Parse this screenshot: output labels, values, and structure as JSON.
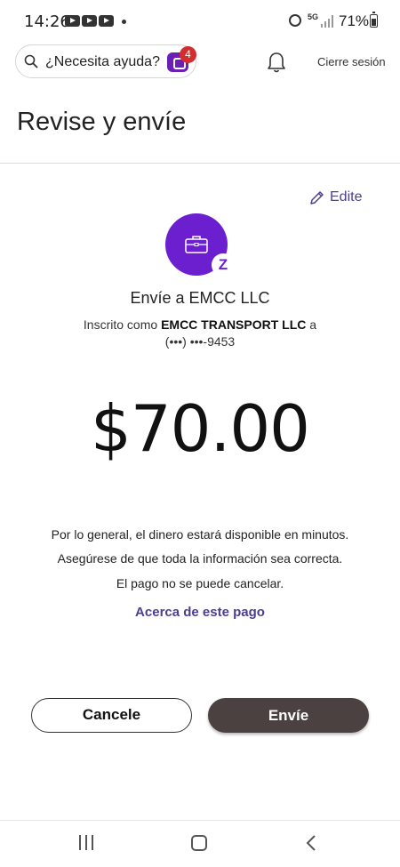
{
  "status_bar": {
    "time": "14:26",
    "battery": "71%",
    "network": "5G"
  },
  "top_nav": {
    "search_placeholder": "¿Necesita ayuda?",
    "chat_badge_count": "4",
    "logout_label": "Cierre sesión"
  },
  "page": {
    "title": "Revise y envíe",
    "edit_label": "Edite"
  },
  "recipient": {
    "send_to": "Envíe a EMCC LLC",
    "enrolled_prefix": "Inscrito como ",
    "enrolled_name": "EMCC TRANSPORT LLC",
    "enrolled_suffix": " a",
    "phone_masked": "(•••) •••-9453"
  },
  "payment": {
    "amount": "$70.00",
    "info_lines": [
      "Por lo general, el dinero estará disponible en minutos.",
      "Asegúrese de que toda la información sea correcta.",
      "El pago no se puede cancelar."
    ],
    "about_link": "Acerca de este pago"
  },
  "actions": {
    "cancel_label": "Cancele",
    "send_label": "Envíe"
  },
  "colors": {
    "brand_purple": "#6c1fcf",
    "link_purple": "#4b3f8f",
    "send_button": "#4a4140",
    "badge_red": "#d42d2d"
  }
}
